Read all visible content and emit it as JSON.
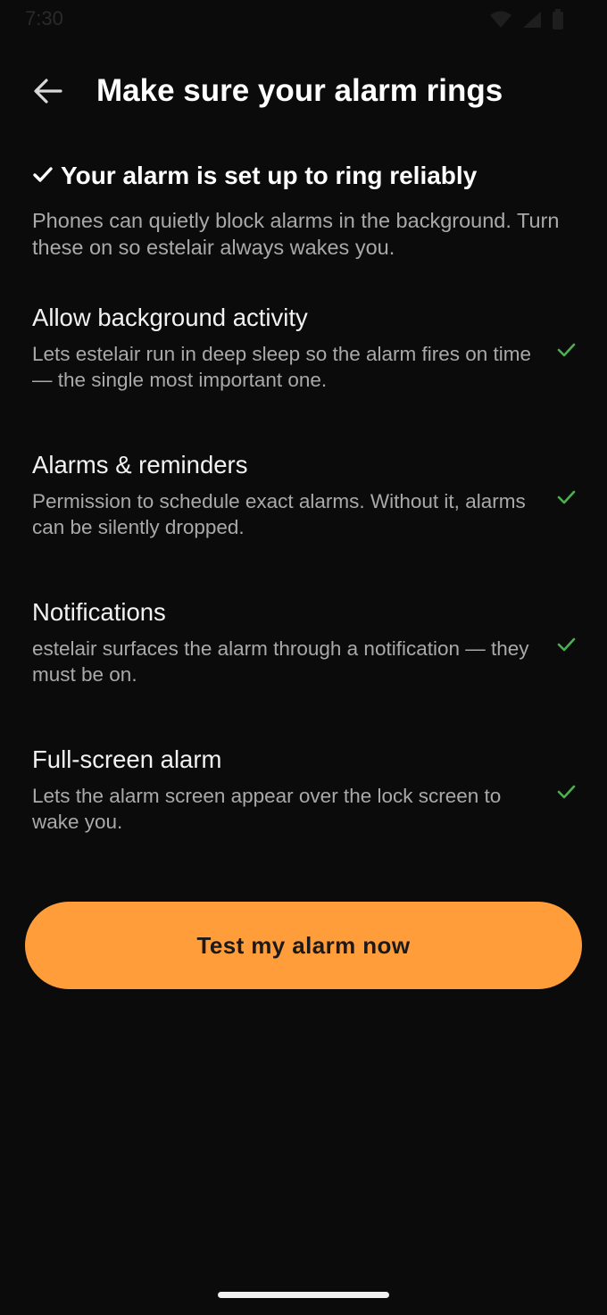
{
  "status_bar": {
    "time": "7:30"
  },
  "header": {
    "back_icon": "arrow-left-icon",
    "title": "Make sure your alarm rings"
  },
  "summary": {
    "status_icon": "check-icon",
    "heading": "Your alarm is set up to ring reliably",
    "text": "Phones can quietly block alarms in the background. Turn these on so estelair always wakes you."
  },
  "permissions": [
    {
      "title": "Allow background activity",
      "description": "Lets estelair run in deep sleep so the alarm fires on time — the single most important one.",
      "status_icon": "check-icon"
    },
    {
      "title": "Alarms & reminders",
      "description": "Permission to schedule exact alarms. Without it, alarms can be silently dropped.",
      "status_icon": "check-icon"
    },
    {
      "title": "Notifications",
      "description": "estelair surfaces the alarm through a notification — they must be on.",
      "status_icon": "check-icon"
    },
    {
      "title": "Full-screen alarm",
      "description": "Lets the alarm screen appear over the lock screen to wake you.",
      "status_icon": "check-icon"
    }
  ],
  "actions": {
    "test_button_label": "Test my alarm now"
  },
  "colors": {
    "background": "#0b0b0b",
    "accent": "#ff9d3b",
    "check_green": "#4caf50",
    "muted_text": "#a9a9a9"
  }
}
